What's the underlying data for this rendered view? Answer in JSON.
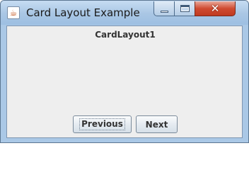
{
  "window": {
    "title": "Card Layout Example",
    "icon": "java-cup-icon",
    "controls": {
      "minimize": "minimize-icon",
      "maximize": "maximize-icon",
      "close": "close-icon",
      "close_glyph": "✕"
    }
  },
  "content": {
    "card_label": "CardLayout1",
    "buttons": {
      "previous": "Previous",
      "next": "Next"
    }
  },
  "colors": {
    "titlebar": "#a9c6e4",
    "close_button": "#cf4b31",
    "client_background": "#eeeeee"
  }
}
